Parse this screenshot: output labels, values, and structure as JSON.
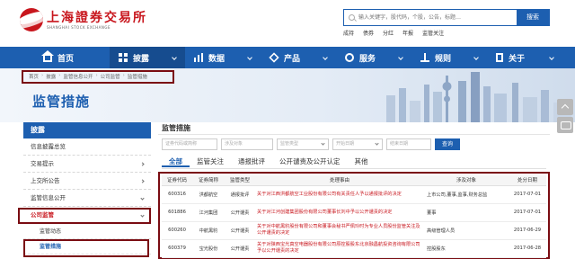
{
  "header": {
    "logo_cn": "上海證券交易所",
    "logo_en": "SHANGHAI STOCK EXCHANGE",
    "search_placeholder": "输入关键字，股代码，个股，公告，标题…",
    "search_button": "搜索",
    "quick_links": [
      "成持",
      "债券",
      "分红",
      "年报",
      "监管关注"
    ]
  },
  "nav": {
    "items": [
      {
        "label": "首页",
        "icon": "home-icon"
      },
      {
        "label": "披露",
        "icon": "grid-icon"
      },
      {
        "label": "数据",
        "icon": "bars-icon"
      },
      {
        "label": "产品",
        "icon": "cube-icon"
      },
      {
        "label": "服务",
        "icon": "gear-icon"
      },
      {
        "label": "规则",
        "icon": "scale-icon"
      },
      {
        "label": "关于",
        "icon": "door-icon"
      }
    ],
    "active_index": 1
  },
  "breadcrumb": [
    "首页",
    "披露",
    "监管信息公开",
    "公司监管",
    "监管措施"
  ],
  "page_title": "监管措施",
  "sidebar": {
    "head": "披露",
    "items": [
      "信息披露总览",
      "交易提示",
      "上交所公告",
      "监管信息公开",
      "公司监管"
    ],
    "sub_items": [
      "监管动态",
      "监管措施"
    ]
  },
  "main": {
    "title": "监管措施",
    "filters": {
      "code_placeholder": "证券代码或简称",
      "object_placeholder": "涉及对象",
      "type_placeholder": "监管类型",
      "start_placeholder": "开始日期",
      "end_placeholder": "结束日期",
      "query_button": "查询"
    },
    "tabs": [
      "全部",
      "监管关注",
      "通报批评",
      "公开谴责及公开认定",
      "其他"
    ],
    "table": {
      "headers": [
        "证券代码",
        "证券简称",
        "监管类型",
        "处理事由",
        "涉及对象",
        "处分日期"
      ],
      "rows": [
        [
          "600316",
          "洪都航空",
          "通报批评",
          "关于对江西洪都航空工业股份有限公司有关责任人予以通报批评的决定",
          "上市公司,董事,监事,财务总监",
          "2017-07-01"
        ],
        [
          "601886",
          "江河集团",
          "公开谴责",
          "关于对江河创建集团股份有限公司董事长刘中予以公开谴责的决定",
          "董事",
          "2017-07-01"
        ],
        [
          "600260",
          "中航黑豹",
          "公开谴责",
          "关于对中航黑豹股份有限公司和董事会秘书严佩玲时为专业人员股份监管关注及公开谴责的决定",
          "高级管理人员",
          "2017-06-29"
        ],
        [
          "600379",
          "宝光股份",
          "公开谴责",
          "关于对陕西宝光真空电器股份有限公司原控股股东北京融昌航投资咨询有限公司予以公开谴责的决定",
          "控股股东",
          "2017-06-28"
        ]
      ]
    }
  },
  "colors": {
    "brand_blue": "#1d5fb0",
    "brand_red": "#c8161d",
    "highlight_box": "#7a0c12"
  }
}
